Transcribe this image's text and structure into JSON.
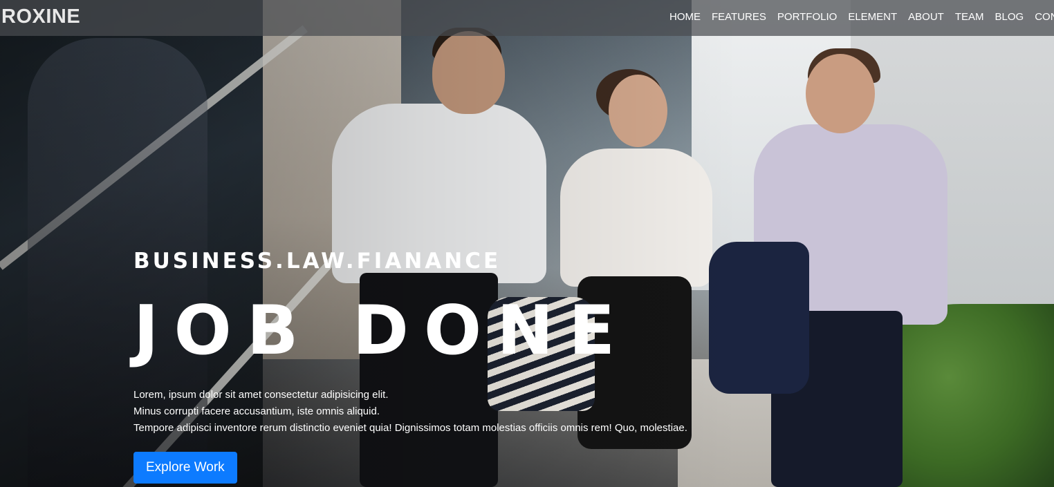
{
  "navbar": {
    "brand": "ROXINE",
    "links": [
      "HOME",
      "FEATURES",
      "PORTFOLIO",
      "ELEMENT",
      "ABOUT",
      "TEAM",
      "BLOG",
      "CONTACT"
    ]
  },
  "hero": {
    "tagline": "BUSINESS.LAW.FIANANCE",
    "headline": "JOB DONE",
    "description_lines": [
      "Lorem, ipsum dolor sit amet consectetur adipisicing elit.",
      "Minus corrupti facere accusantium, iste omnis aliquid.",
      "Tempore adipisci inventore rerum distinctio eveniet quia! Dignissimos totam molestias officiis omnis rem! Quo, molestiae."
    ],
    "cta_label": "Explore Work",
    "accent_color": "#0d7bff"
  }
}
